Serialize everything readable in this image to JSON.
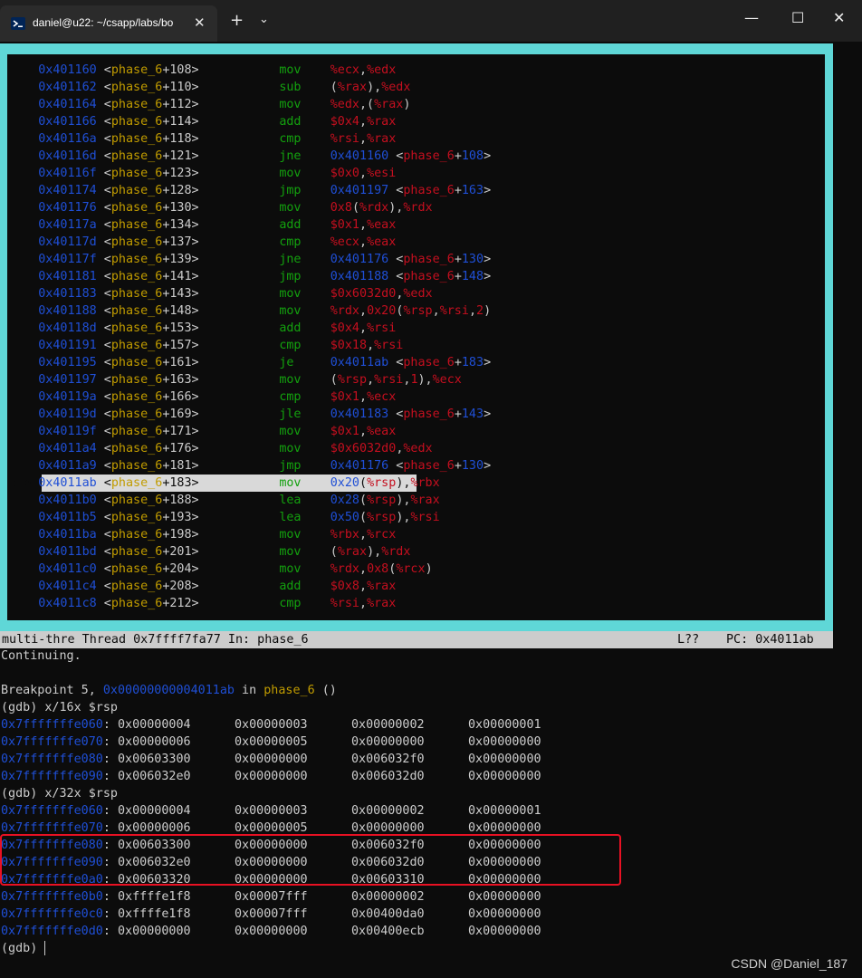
{
  "window": {
    "tab_title": "daniel@u22: ~/csapp/labs/bo",
    "close_tab_glyph": "✕",
    "new_tab_glyph": "+",
    "dropdown_glyph": "⌄",
    "minimize_glyph": "—",
    "maximize_glyph": "☐",
    "close_glyph": "✕",
    "icons": [
      "terminal-icon",
      "close-icon",
      "plus-icon",
      "chevron-down-icon",
      "minimize-icon",
      "maximize-icon",
      "close-icon"
    ]
  },
  "colors": {
    "frame": "#5fd7d7",
    "address": "#1f4fd6",
    "function": "#c19c00",
    "mnemonic": "#13a10e",
    "register": "#c50f1f",
    "highlight_box": "#e81123"
  },
  "disasm": [
    {
      "marker": "",
      "addr": "0x401160",
      "off": "108",
      "mn": "mov",
      "ops": [
        [
          "r",
          "%ecx"
        ],
        [
          "p",
          ","
        ],
        [
          "r",
          "%edx"
        ]
      ]
    },
    {
      "marker": "",
      "addr": "0x401162",
      "off": "110",
      "mn": "sub",
      "ops": [
        [
          "p",
          "("
        ],
        [
          "r",
          "%rax"
        ],
        [
          "p",
          "),"
        ],
        [
          "r",
          "%edx"
        ]
      ]
    },
    {
      "marker": "",
      "addr": "0x401164",
      "off": "112",
      "mn": "mov",
      "ops": [
        [
          "r",
          "%edx"
        ],
        [
          "p",
          ",("
        ],
        [
          "r",
          "%rax"
        ],
        [
          "p",
          ")"
        ]
      ]
    },
    {
      "marker": "",
      "addr": "0x401166",
      "off": "114",
      "mn": "add",
      "ops": [
        [
          "r",
          "$0x4"
        ],
        [
          "p",
          ","
        ],
        [
          "r",
          "%rax"
        ]
      ]
    },
    {
      "marker": "",
      "addr": "0x40116a",
      "off": "118",
      "mn": "cmp",
      "ops": [
        [
          "r",
          "%rsi"
        ],
        [
          "p",
          ","
        ],
        [
          "r",
          "%rax"
        ]
      ]
    },
    {
      "marker": "",
      "addr": "0x40116d",
      "off": "121",
      "mn": "jne",
      "ops": [
        [
          "a",
          "0x401160"
        ],
        [
          "p",
          " <"
        ],
        [
          "rf",
          "phase_6"
        ],
        [
          "p",
          "+"
        ],
        [
          "a",
          "108"
        ],
        [
          "p",
          ">"
        ]
      ]
    },
    {
      "marker": "",
      "addr": "0x40116f",
      "off": "123",
      "mn": "mov",
      "ops": [
        [
          "r",
          "$0x0"
        ],
        [
          "p",
          ","
        ],
        [
          "r",
          "%esi"
        ]
      ]
    },
    {
      "marker": "",
      "addr": "0x401174",
      "off": "128",
      "mn": "jmp",
      "ops": [
        [
          "a",
          "0x401197"
        ],
        [
          "p",
          " <"
        ],
        [
          "rf",
          "phase_6"
        ],
        [
          "p",
          "+"
        ],
        [
          "a",
          "163"
        ],
        [
          "p",
          ">"
        ]
      ]
    },
    {
      "marker": "",
      "addr": "0x401176",
      "off": "130",
      "mn": "mov",
      "ops": [
        [
          "r",
          "0x8"
        ],
        [
          "p",
          "("
        ],
        [
          "r",
          "%rdx"
        ],
        [
          "p",
          "),"
        ],
        [
          "r",
          "%rdx"
        ]
      ]
    },
    {
      "marker": "",
      "addr": "0x40117a",
      "off": "134",
      "mn": "add",
      "ops": [
        [
          "r",
          "$0x1"
        ],
        [
          "p",
          ","
        ],
        [
          "r",
          "%eax"
        ]
      ]
    },
    {
      "marker": "",
      "addr": "0x40117d",
      "off": "137",
      "mn": "cmp",
      "ops": [
        [
          "r",
          "%ecx"
        ],
        [
          "p",
          ","
        ],
        [
          "r",
          "%eax"
        ]
      ]
    },
    {
      "marker": "",
      "addr": "0x40117f",
      "off": "139",
      "mn": "jne",
      "ops": [
        [
          "a",
          "0x401176"
        ],
        [
          "p",
          " <"
        ],
        [
          "rf",
          "phase_6"
        ],
        [
          "p",
          "+"
        ],
        [
          "a",
          "130"
        ],
        [
          "p",
          ">"
        ]
      ]
    },
    {
      "marker": "",
      "addr": "0x401181",
      "off": "141",
      "mn": "jmp",
      "ops": [
        [
          "a",
          "0x401188"
        ],
        [
          "p",
          " <"
        ],
        [
          "rf",
          "phase_6"
        ],
        [
          "p",
          "+"
        ],
        [
          "a",
          "148"
        ],
        [
          "p",
          ">"
        ]
      ]
    },
    {
      "marker": "",
      "addr": "0x401183",
      "off": "143",
      "mn": "mov",
      "ops": [
        [
          "r",
          "$0x6032d0"
        ],
        [
          "p",
          ","
        ],
        [
          "r",
          "%edx"
        ]
      ]
    },
    {
      "marker": "",
      "addr": "0x401188",
      "off": "148",
      "mn": "mov",
      "ops": [
        [
          "r",
          "%rdx"
        ],
        [
          "p",
          ","
        ],
        [
          "r",
          "0x20"
        ],
        [
          "p",
          "("
        ],
        [
          "r",
          "%rsp"
        ],
        [
          "p",
          ","
        ],
        [
          "r",
          "%rsi"
        ],
        [
          "p",
          ","
        ],
        [
          "r",
          "2"
        ],
        [
          "p",
          ")"
        ]
      ]
    },
    {
      "marker": "",
      "addr": "0x40118d",
      "off": "153",
      "mn": "add",
      "ops": [
        [
          "r",
          "$0x4"
        ],
        [
          "p",
          ","
        ],
        [
          "r",
          "%rsi"
        ]
      ]
    },
    {
      "marker": "",
      "addr": "0x401191",
      "off": "157",
      "mn": "cmp",
      "ops": [
        [
          "r",
          "$0x18"
        ],
        [
          "p",
          ","
        ],
        [
          "r",
          "%rsi"
        ]
      ]
    },
    {
      "marker": "",
      "addr": "0x401195",
      "off": "161",
      "mn": "je",
      "ops": [
        [
          "a",
          "0x4011ab"
        ],
        [
          "p",
          " <"
        ],
        [
          "rf",
          "phase_6"
        ],
        [
          "p",
          "+"
        ],
        [
          "a",
          "183"
        ],
        [
          "p",
          ">"
        ]
      ]
    },
    {
      "marker": "",
      "addr": "0x401197",
      "off": "163",
      "mn": "mov",
      "ops": [
        [
          "p",
          "("
        ],
        [
          "r",
          "%rsp"
        ],
        [
          "p",
          ","
        ],
        [
          "r",
          "%rsi"
        ],
        [
          "p",
          ","
        ],
        [
          "r",
          "1"
        ],
        [
          "p",
          "),"
        ],
        [
          "r",
          "%ecx"
        ]
      ]
    },
    {
      "marker": "",
      "addr": "0x40119a",
      "off": "166",
      "mn": "cmp",
      "ops": [
        [
          "r",
          "$0x1"
        ],
        [
          "p",
          ","
        ],
        [
          "r",
          "%ecx"
        ]
      ]
    },
    {
      "marker": "",
      "addr": "0x40119d",
      "off": "169",
      "mn": "jle",
      "ops": [
        [
          "a",
          "0x401183"
        ],
        [
          "p",
          " <"
        ],
        [
          "rf",
          "phase_6"
        ],
        [
          "p",
          "+"
        ],
        [
          "a",
          "143"
        ],
        [
          "p",
          ">"
        ]
      ]
    },
    {
      "marker": "",
      "addr": "0x40119f",
      "off": "171",
      "mn": "mov",
      "ops": [
        [
          "r",
          "$0x1"
        ],
        [
          "p",
          ","
        ],
        [
          "r",
          "%eax"
        ]
      ]
    },
    {
      "marker": "",
      "addr": "0x4011a4",
      "off": "176",
      "mn": "mov",
      "ops": [
        [
          "r",
          "$0x6032d0"
        ],
        [
          "p",
          ","
        ],
        [
          "r",
          "%edx"
        ]
      ]
    },
    {
      "marker": "",
      "addr": "0x4011a9",
      "off": "181",
      "mn": "jmp",
      "ops": [
        [
          "a",
          "0x401176"
        ],
        [
          "p",
          " <"
        ],
        [
          "rf",
          "phase_6"
        ],
        [
          "p",
          "+"
        ],
        [
          "a",
          "130"
        ],
        [
          "p",
          ">"
        ]
      ]
    },
    {
      "marker": "B+>",
      "addr": "0x4011ab",
      "off": "183",
      "mn": "mov",
      "current": true,
      "ops": [
        [
          "a",
          "0x20"
        ],
        [
          "p",
          "("
        ],
        [
          "r",
          "%rsp"
        ],
        [
          "p",
          "),"
        ],
        [
          "r",
          "%rbx"
        ]
      ]
    },
    {
      "marker": "",
      "addr": "0x4011b0",
      "off": "188",
      "mn": "lea",
      "ops": [
        [
          "a",
          "0x28"
        ],
        [
          "p",
          "("
        ],
        [
          "r",
          "%rsp"
        ],
        [
          "p",
          "),"
        ],
        [
          "r",
          "%rax"
        ]
      ]
    },
    {
      "marker": "",
      "addr": "0x4011b5",
      "off": "193",
      "mn": "lea",
      "ops": [
        [
          "a",
          "0x50"
        ],
        [
          "p",
          "("
        ],
        [
          "r",
          "%rsp"
        ],
        [
          "p",
          "),"
        ],
        [
          "r",
          "%rsi"
        ]
      ]
    },
    {
      "marker": "",
      "addr": "0x4011ba",
      "off": "198",
      "mn": "mov",
      "ops": [
        [
          "r",
          "%rbx"
        ],
        [
          "p",
          ","
        ],
        [
          "r",
          "%rcx"
        ]
      ]
    },
    {
      "marker": "",
      "addr": "0x4011bd",
      "off": "201",
      "mn": "mov",
      "ops": [
        [
          "p",
          "("
        ],
        [
          "r",
          "%rax"
        ],
        [
          "p",
          "),"
        ],
        [
          "r",
          "%rdx"
        ]
      ]
    },
    {
      "marker": "",
      "addr": "0x4011c0",
      "off": "204",
      "mn": "mov",
      "ops": [
        [
          "r",
          "%rdx"
        ],
        [
          "p",
          ","
        ],
        [
          "r",
          "0x8"
        ],
        [
          "p",
          "("
        ],
        [
          "r",
          "%rcx"
        ],
        [
          "p",
          ")"
        ]
      ]
    },
    {
      "marker": "",
      "addr": "0x4011c4",
      "off": "208",
      "mn": "add",
      "ops": [
        [
          "r",
          "$0x8"
        ],
        [
          "p",
          ","
        ],
        [
          "r",
          "%rax"
        ]
      ]
    },
    {
      "marker": "",
      "addr": "0x4011c8",
      "off": "212",
      "mn": "cmp",
      "ops": [
        [
          "r",
          "%rsi"
        ],
        [
          "p",
          ","
        ],
        [
          "r",
          "%rax"
        ]
      ]
    }
  ],
  "func_name": "phase_6",
  "status": {
    "left": "multi-thre Thread 0x7ffff7fa77 In: phase_6",
    "line": "L??",
    "pc": "PC: 0x4011ab"
  },
  "console": {
    "continuing": "Continuing.",
    "bp_prefix": "Breakpoint 5, ",
    "bp_addr": "0x00000000004011ab",
    "bp_in": " in ",
    "bp_func": "phase_6",
    "bp_suffix": " ()",
    "cmd1": "(gdb) x/16x $rsp",
    "mem1": [
      {
        "addr": "0x7fffffffe060",
        "vals": [
          "0x00000004",
          "0x00000003",
          "0x00000002",
          "0x00000001"
        ]
      },
      {
        "addr": "0x7fffffffe070",
        "vals": [
          "0x00000006",
          "0x00000005",
          "0x00000000",
          "0x00000000"
        ]
      },
      {
        "addr": "0x7fffffffe080",
        "vals": [
          "0x00603300",
          "0x00000000",
          "0x006032f0",
          "0x00000000"
        ]
      },
      {
        "addr": "0x7fffffffe090",
        "vals": [
          "0x006032e0",
          "0x00000000",
          "0x006032d0",
          "0x00000000"
        ]
      }
    ],
    "cmd2": "(gdb) x/32x $rsp",
    "mem2": [
      {
        "addr": "0x7fffffffe060",
        "vals": [
          "0x00000004",
          "0x00000003",
          "0x00000002",
          "0x00000001"
        ]
      },
      {
        "addr": "0x7fffffffe070",
        "vals": [
          "0x00000006",
          "0x00000005",
          "0x00000000",
          "0x00000000"
        ]
      },
      {
        "addr": "0x7fffffffe080",
        "vals": [
          "0x00603300",
          "0x00000000",
          "0x006032f0",
          "0x00000000"
        ]
      },
      {
        "addr": "0x7fffffffe090",
        "vals": [
          "0x006032e0",
          "0x00000000",
          "0x006032d0",
          "0x00000000"
        ]
      },
      {
        "addr": "0x7fffffffe0a0",
        "vals": [
          "0x00603320",
          "0x00000000",
          "0x00603310",
          "0x00000000"
        ]
      },
      {
        "addr": "0x7fffffffe0b0",
        "vals": [
          "0xffffe1f8",
          "0x00007fff",
          "0x00000002",
          "0x00000000"
        ]
      },
      {
        "addr": "0x7fffffffe0c0",
        "vals": [
          "0xffffe1f8",
          "0x00007fff",
          "0x00400da0",
          "0x00000000"
        ]
      },
      {
        "addr": "0x7fffffffe0d0",
        "vals": [
          "0x00000000",
          "0x00000000",
          "0x00400ecb",
          "0x00000000"
        ]
      }
    ],
    "prompt": "(gdb) "
  },
  "watermark": "CSDN @Daniel_187"
}
